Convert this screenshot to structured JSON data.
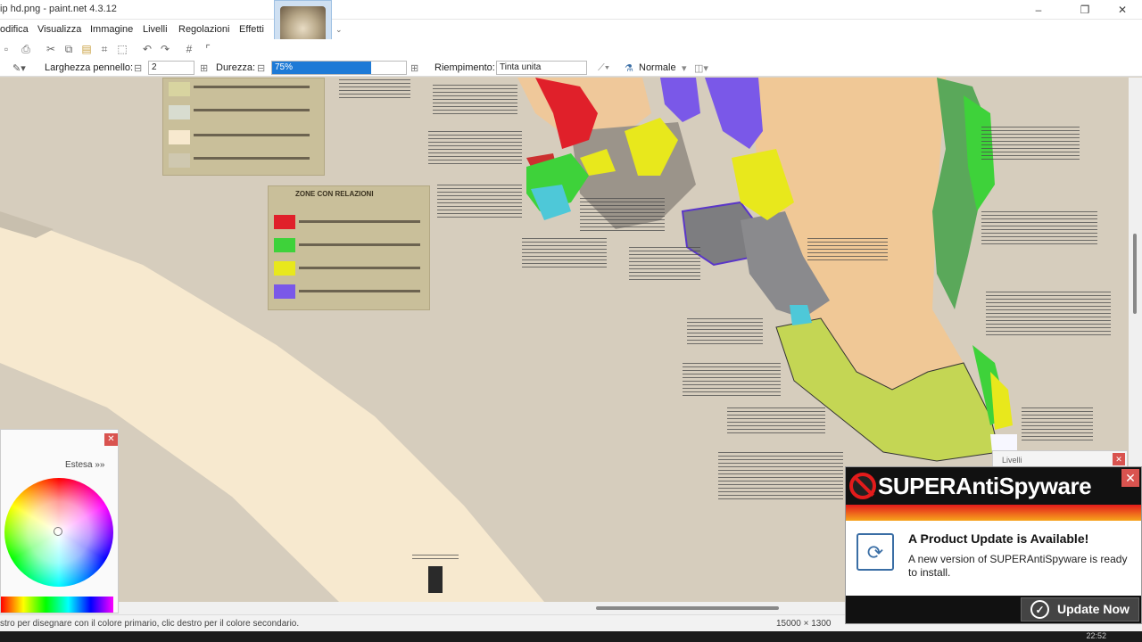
{
  "window": {
    "title": "ip hd.png - paint.net 4.3.12",
    "minimize": "–",
    "maximize": "❐",
    "close": "✕"
  },
  "menu": [
    "odifica",
    "Visualizza",
    "Immagine",
    "Livelli",
    "Regolazioni",
    "Effetti"
  ],
  "propbar": {
    "brush_width_label": "Larghezza pennello:",
    "brush_width_value": "2",
    "hardness_label": "Durezza:",
    "hardness_value": "75%",
    "fill_label": "Riempimento:",
    "fill_value": "Tinta unita",
    "blend_value": "Normale"
  },
  "palette": {
    "mode_label": "Estesa »»"
  },
  "layers": {
    "title": "Livelli"
  },
  "legend": {
    "title": "ZONE CON RELAZIONI"
  },
  "status": {
    "hint": "stro per disegnare con il colore primario, clic destro per il colore secondario.",
    "image_size": "15000 × 1300",
    "clock": "22:52"
  },
  "popup": {
    "brand": "SUPERAntiSpyware",
    "headline": "A Product Update is Available!",
    "message": "A new version of SUPERAntiSpyware is ready to install.",
    "button": "Update Now",
    "close": "✕"
  },
  "colors": {
    "red": "#e0202a",
    "green": "#3ed23a",
    "yellow": "#e8e81c",
    "purple": "#7a58e8",
    "gray": "#7d7d80",
    "tan": "#f0c896",
    "lime": "#c4d654",
    "forest": "#5aa85a",
    "cyan": "#4ec8d8"
  },
  "icons": {
    "print": "print-icon",
    "undo": "undo-icon",
    "redo": "redo-icon",
    "grid": "grid-icon",
    "settings": "gear-icon",
    "help": "help-icon",
    "update": "refresh-icon"
  }
}
